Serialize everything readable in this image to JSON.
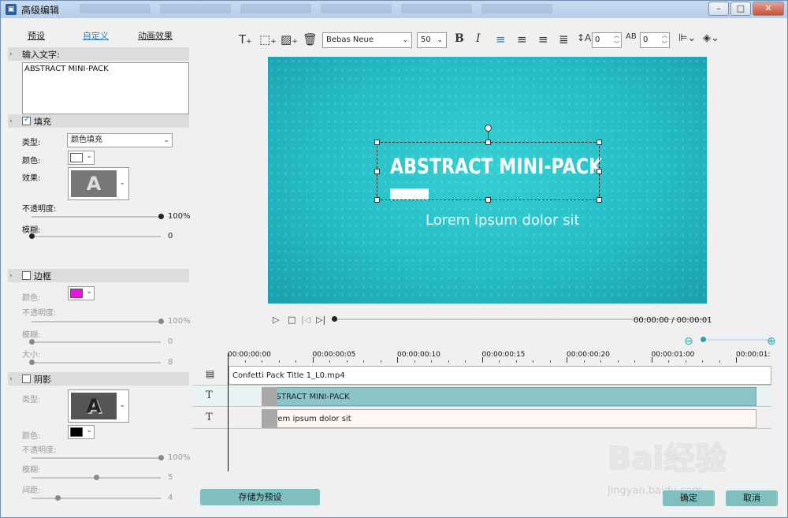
{
  "window": {
    "title": "高级编辑",
    "min": "–",
    "max": "□",
    "close": "✕"
  },
  "left_tabs": {
    "preset": "预设",
    "custom": "自定义",
    "animation": "动画效果"
  },
  "input_section": {
    "label": "输入文字:",
    "text": "ABSTRACT MINI-PACK"
  },
  "fill": {
    "label": "填充",
    "checked": true,
    "type_label": "类型:",
    "type_value": "颜色填充",
    "color_label": "颜色:",
    "color": "#ffffff",
    "effect_label": "效果:",
    "effect_glyph": "A",
    "opacity_label": "不透明度:",
    "opacity_value": "100%",
    "opacity_level": 1.0,
    "blur_label": "模糊:",
    "blur_value": "0",
    "blur_level": 0.0
  },
  "border": {
    "label": "边框",
    "checked": false,
    "color_label": "颜色:",
    "color": "#e815e0",
    "opacity_label": "不透明度:",
    "opacity_value": "100%",
    "opacity_level": 1.0,
    "blur_label": "模糊:",
    "blur_value": "0",
    "blur_level": 0.0,
    "size_label": "大小:",
    "size_value": "8",
    "size_level": 0.0
  },
  "shadow": {
    "label": "阴影",
    "checked": false,
    "type_label": "类型:",
    "type_glyph": "A",
    "color_label": "颜色:",
    "color": "#000000",
    "opacity_label": "不透明度:",
    "opacity_value": "100%",
    "opacity_level": 1.0,
    "blur_label": "模糊:",
    "blur_value": "5",
    "blur_level": 0.5,
    "distance_label": "间距:",
    "distance_value": "4",
    "distance_level": 0.2
  },
  "save_preset": "存储为预设",
  "toolbar": {
    "font": "Bebas Neue",
    "size": "50",
    "bold": "B",
    "italic": "I",
    "line_spacing": "0",
    "char_spacing": "0",
    "icons": [
      "add-text-icon",
      "resize-icon",
      "add-image-icon",
      "delete-icon",
      "align-left-icon",
      "align-center-icon",
      "align-right-icon",
      "justify-icon",
      "line-spacing-icon",
      "char-spacing-icon",
      "align-objects-icon",
      "layers-icon"
    ]
  },
  "preview": {
    "title": "ABSTRACT MINI-PACK",
    "subtitle": "Lorem ipsum dolor sit",
    "bg_color": "#24bdc6"
  },
  "player": {
    "timecode": "00:00:00 / 00:00:01",
    "play": "▷",
    "stop": "□",
    "prev": "|◁",
    "next": "▷|"
  },
  "timeline": {
    "ticks": [
      "00:00:00:00",
      "00:00:00:05",
      "00:00:00:10",
      "00:00:00:15",
      "00:00:00:20",
      "00:00:01:00",
      "00:00:01:"
    ],
    "tracks": [
      {
        "icon": "film-icon",
        "clip": "Confetti Pack Title 1_L0.mp4"
      },
      {
        "icon": "T",
        "clip": "ABSTRACT MINI-PACK"
      },
      {
        "icon": "T",
        "clip": "Lorem ipsum dolor sit"
      }
    ]
  },
  "buttons": {
    "ok": "确定",
    "cancel": "取消"
  },
  "watermark": {
    "main": "Bai经验",
    "sub": "jingyan.baidu.com"
  }
}
